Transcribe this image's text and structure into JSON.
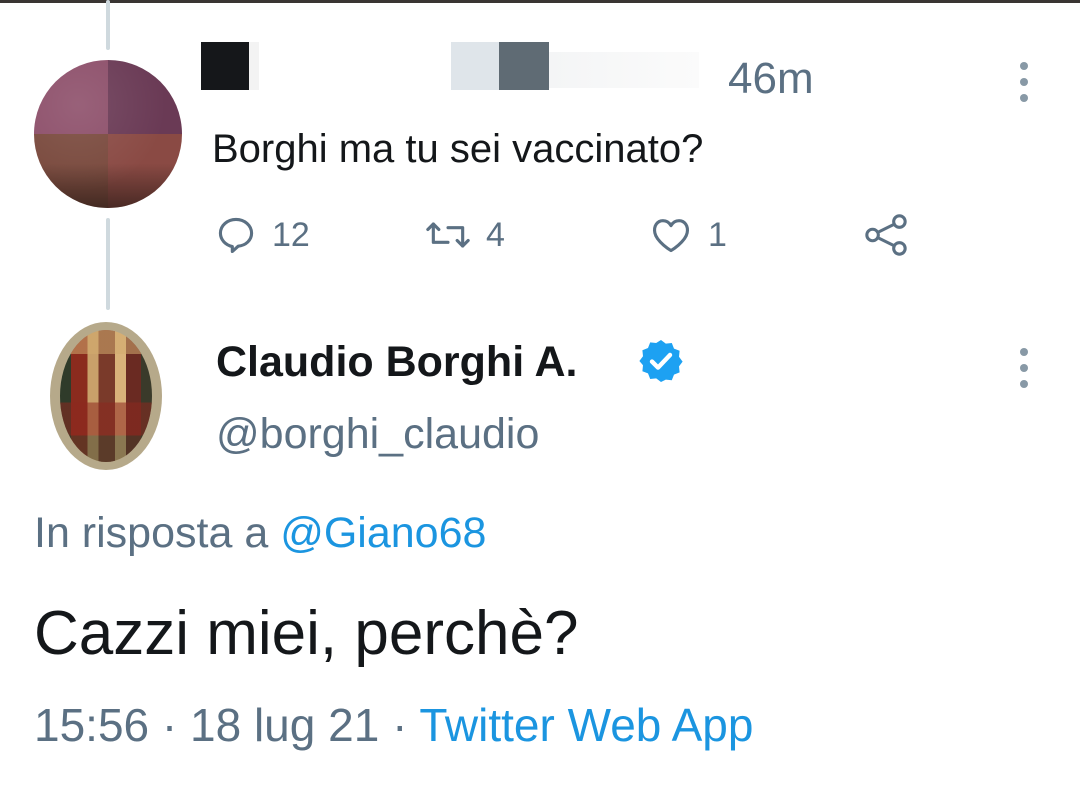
{
  "parent_tweet": {
    "time": "46m",
    "text": "Borghi ma tu sei vaccinato?",
    "actions": {
      "reply_count": "12",
      "retweet_count": "4",
      "like_count": "1"
    }
  },
  "main_tweet": {
    "name": "Claudio Borghi A.",
    "handle": "@borghi_claudio",
    "reply_prefix": "In risposta a",
    "reply_mention": "@Giano68",
    "text": "Cazzi miei, perchè?",
    "time": "15:56",
    "separator": "·",
    "date": "18 lug 21",
    "source": "Twitter Web App"
  },
  "colors": {
    "text_primary": "#14171a",
    "text_secondary": "#5b7083",
    "accent": "#1b95e0",
    "verified": "#1da1f2",
    "thread_line": "#cfd9de"
  },
  "icons": [
    "reply-icon",
    "retweet-icon",
    "like-icon",
    "share-icon",
    "more-icon",
    "verified-badge-icon"
  ]
}
